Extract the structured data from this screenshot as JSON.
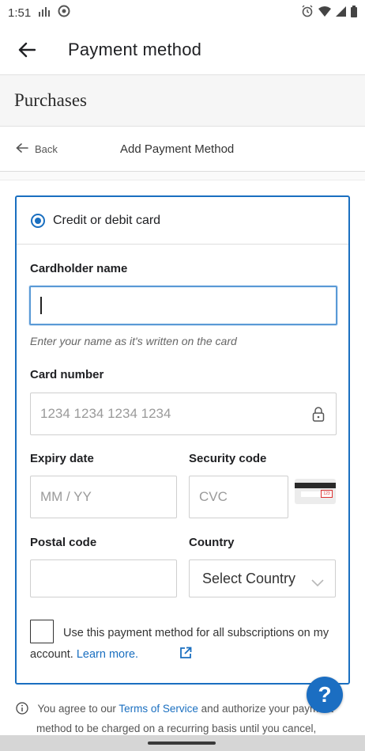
{
  "status_bar": {
    "time": "1:51"
  },
  "app_bar": {
    "title": "Payment method"
  },
  "purchases": {
    "title": "Purchases"
  },
  "subnav": {
    "back_label": "Back",
    "title": "Add Payment Method"
  },
  "form": {
    "payment_type_label": "Credit or debit card",
    "cardholder": {
      "label": "Cardholder name",
      "value": "",
      "helper": "Enter your name as it's written on the card"
    },
    "card_number": {
      "label": "Card number",
      "placeholder": "1234 1234 1234 1234"
    },
    "expiry": {
      "label": "Expiry date",
      "placeholder": "MM / YY"
    },
    "security_code": {
      "label": "Security code",
      "placeholder": "CVC",
      "card_hint_text": "123"
    },
    "postal_code": {
      "label": "Postal code",
      "value": ""
    },
    "country": {
      "label": "Country",
      "selected": "Select Country"
    },
    "consent": {
      "text": "Use this payment method for all subscriptions on my account.",
      "link": "Learn more."
    }
  },
  "footer": {
    "prefix": "You agree to our",
    "terms_link": "Terms of Service",
    "middle": "and authorize your payment",
    "line2": "method to be charged on a recurring basis until you cancel,"
  },
  "help_fab": {
    "label": "?"
  },
  "colors": {
    "accent": "#1a6fc0",
    "help_fab": "#1b6ec2",
    "band_bg": "#f6f6f6"
  }
}
